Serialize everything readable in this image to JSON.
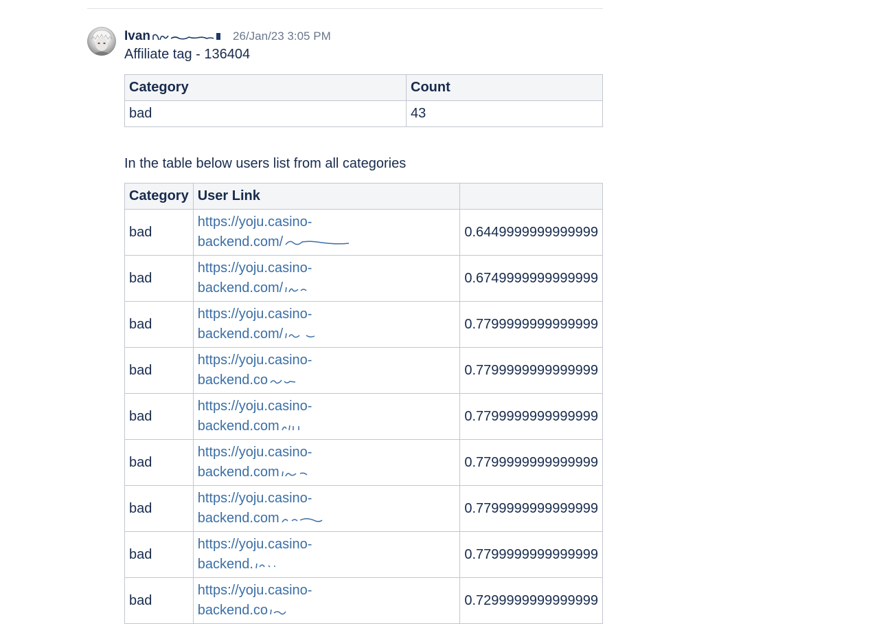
{
  "comment": {
    "author": "Ivan",
    "timestamp": "26/Jan/23 3:05 PM",
    "intro": "Affiliate tag - 136404",
    "summary_table": {
      "headers": [
        "Category",
        "Count"
      ],
      "rows": [
        {
          "category": "bad",
          "count": "43"
        }
      ]
    },
    "caption": "In the table below users list from all categories",
    "users_table": {
      "headers": [
        "Category",
        "User Link",
        ""
      ],
      "rows": [
        {
          "category": "bad",
          "link_line1": "https://yoju.casino-",
          "link_line2": "backend.com/",
          "score": "0.6449999999999999"
        },
        {
          "category": "bad",
          "link_line1": "https://yoju.casino-",
          "link_line2": "backend.com/",
          "score": "0.6749999999999999"
        },
        {
          "category": "bad",
          "link_line1": "https://yoju.casino-",
          "link_line2": "backend.com/",
          "score": "0.7799999999999999"
        },
        {
          "category": "bad",
          "link_line1": "https://yoju.casino-",
          "link_line2": "backend.co",
          "score": "0.7799999999999999"
        },
        {
          "category": "bad",
          "link_line1": "https://yoju.casino-",
          "link_line2": "backend.com",
          "score": "0.7799999999999999"
        },
        {
          "category": "bad",
          "link_line1": "https://yoju.casino-",
          "link_line2": "backend.com",
          "score": "0.7799999999999999"
        },
        {
          "category": "bad",
          "link_line1": "https://yoju.casino-",
          "link_line2": "backend.com",
          "score": "0.7799999999999999"
        },
        {
          "category": "bad",
          "link_line1": "https://yoju.casino-",
          "link_line2": "backend.",
          "score": "0.7799999999999999"
        },
        {
          "category": "bad",
          "link_line1": "https://yoju.casino-",
          "link_line2": "backend.co",
          "score": "0.7299999999999999"
        }
      ]
    }
  },
  "colors": {
    "text": "#172b4d",
    "link": "#3a6ea5",
    "meta": "#6b778c",
    "border": "#c1c7d0",
    "header_bg": "#f4f5f7"
  }
}
